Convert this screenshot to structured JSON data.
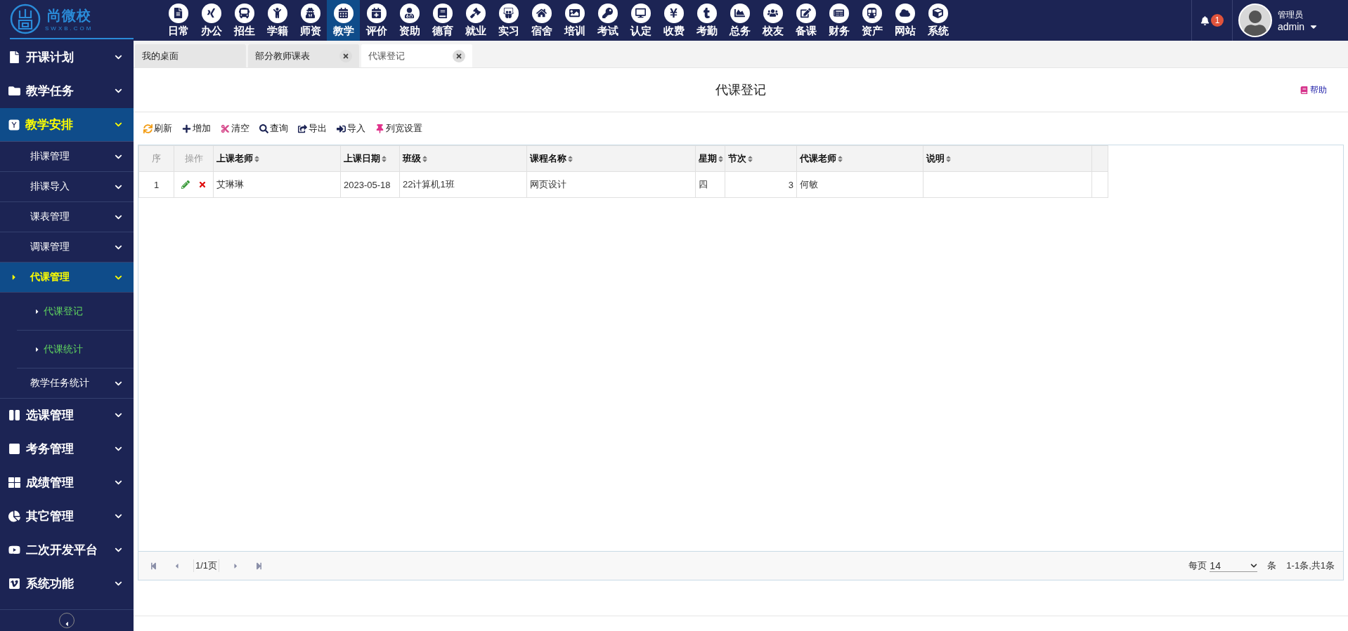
{
  "logo": {
    "name": "尚微校",
    "domain": "SWXB.COM"
  },
  "nav": [
    {
      "label": "日常",
      "selected": false
    },
    {
      "label": "办公",
      "selected": false
    },
    {
      "label": "招生",
      "selected": false
    },
    {
      "label": "学籍",
      "selected": false
    },
    {
      "label": "师资",
      "selected": false
    },
    {
      "label": "教学",
      "selected": true
    },
    {
      "label": "评价",
      "selected": false
    },
    {
      "label": "资助",
      "selected": false
    },
    {
      "label": "德育",
      "selected": false
    },
    {
      "label": "就业",
      "selected": false
    },
    {
      "label": "实习",
      "selected": false
    },
    {
      "label": "宿舍",
      "selected": false
    },
    {
      "label": "培训",
      "selected": false
    },
    {
      "label": "考试",
      "selected": false
    },
    {
      "label": "认定",
      "selected": false
    },
    {
      "label": "收费",
      "selected": false
    },
    {
      "label": "考勤",
      "selected": false
    },
    {
      "label": "总务",
      "selected": false
    },
    {
      "label": "校友",
      "selected": false
    },
    {
      "label": "备课",
      "selected": false
    },
    {
      "label": "财务",
      "selected": false
    },
    {
      "label": "资产",
      "selected": false
    },
    {
      "label": "网站",
      "selected": false
    },
    {
      "label": "系统",
      "selected": false
    }
  ],
  "notifications": {
    "count": "1"
  },
  "user": {
    "role": "管理员",
    "name": "admin"
  },
  "sidebar": {
    "items": [
      {
        "label": "开课计划",
        "selected": false
      },
      {
        "label": "教学任务",
        "selected": false
      },
      {
        "label": "教学安排",
        "selected": true,
        "expanded": true,
        "children": [
          {
            "label": "排课管理",
            "selected": false
          },
          {
            "label": "排课导入",
            "selected": false
          },
          {
            "label": "课表管理",
            "selected": false
          },
          {
            "label": "调课管理",
            "selected": false
          },
          {
            "label": "代课管理",
            "selected": true,
            "expanded": true,
            "children": [
              {
                "label": "代课登记"
              },
              {
                "label": "代课统计"
              }
            ]
          },
          {
            "label": "教学任务统计",
            "selected": false
          }
        ]
      },
      {
        "label": "选课管理",
        "selected": false
      },
      {
        "label": "考务管理",
        "selected": false
      },
      {
        "label": "成绩管理",
        "selected": false
      },
      {
        "label": "其它管理",
        "selected": false
      },
      {
        "label": "二次开发平台",
        "selected": false
      },
      {
        "label": "系统功能",
        "selected": false
      }
    ]
  },
  "tabs": [
    {
      "label": "我的桌面",
      "selected": false,
      "closable": false
    },
    {
      "label": "部分教师课表",
      "selected": false,
      "closable": true
    },
    {
      "label": "代课登记",
      "selected": true,
      "closable": true
    }
  ],
  "page_title": "代课登记",
  "help": "帮助",
  "toolbar": [
    {
      "kind": "refresh",
      "label": "刷新"
    },
    {
      "kind": "add",
      "label": "增加"
    },
    {
      "kind": "clear",
      "label": "清空"
    },
    {
      "kind": "search",
      "label": "查询"
    },
    {
      "kind": "export",
      "label": "导出"
    },
    {
      "kind": "import",
      "label": "导入"
    },
    {
      "kind": "pin",
      "label": "列宽设置"
    }
  ],
  "table": {
    "columns": [
      {
        "label": "序",
        "sortable": false
      },
      {
        "label": "操作",
        "sortable": false
      },
      {
        "label": "上课老师",
        "sortable": true
      },
      {
        "label": "上课日期",
        "sortable": true
      },
      {
        "label": "班级",
        "sortable": true
      },
      {
        "label": "课程名称",
        "sortable": true
      },
      {
        "label": "星期",
        "sortable": true
      },
      {
        "label": "节次",
        "sortable": true
      },
      {
        "label": "代课老师",
        "sortable": true
      },
      {
        "label": "说明",
        "sortable": true
      }
    ],
    "rows": [
      {
        "index": "1",
        "teacher": "艾琳琳",
        "date": "2023-05-18",
        "class": "22计算机1班",
        "course": "网页设计",
        "weekday": "四",
        "period": "3",
        "substitute": "何敏"
      }
    ]
  },
  "pagination": {
    "page": "1/1页",
    "per_page_label": "每页",
    "per_page": "14",
    "unit": "条",
    "summary": "1-1条,共1条"
  }
}
